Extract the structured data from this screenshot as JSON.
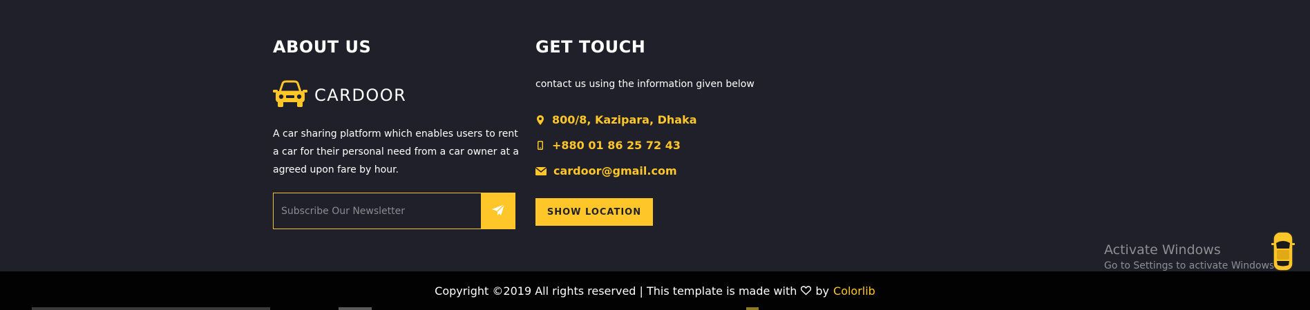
{
  "about": {
    "title": "ABOUT US",
    "brand": "CARDOOR",
    "description": "A car sharing platform which enables users to rent a car for their personal need from a car owner at a agreed upon fare by hour.",
    "newsletter_placeholder": "Subscribe Our Newsletter"
  },
  "contact": {
    "title": "GET TOUCH",
    "intro": "contact us using the information given below",
    "address": "800/8, Kazipara, Dhaka",
    "phone": "+880 01 86 25 72 43",
    "email": "cardoor@gmail.com",
    "button_label": "SHOW LOCATION"
  },
  "watermark": {
    "title": "Activate Windows",
    "subtitle": "Go to Settings to activate Windows."
  },
  "copyright": {
    "text": "Copyright ©2019 All rights reserved | This template is made with",
    "by": "by",
    "link": "Colorlib"
  },
  "colors": {
    "accent": "#ffc629",
    "background": "#1f2029",
    "bottom_bar": "#020202"
  },
  "icons": {
    "brand": "car-front-icon",
    "address": "map-marker-icon",
    "phone": "mobile-phone-icon",
    "email": "envelope-icon",
    "send": "paper-plane-icon",
    "heart": "heart-outline-icon",
    "scroll_top": "car-top-view-icon"
  }
}
